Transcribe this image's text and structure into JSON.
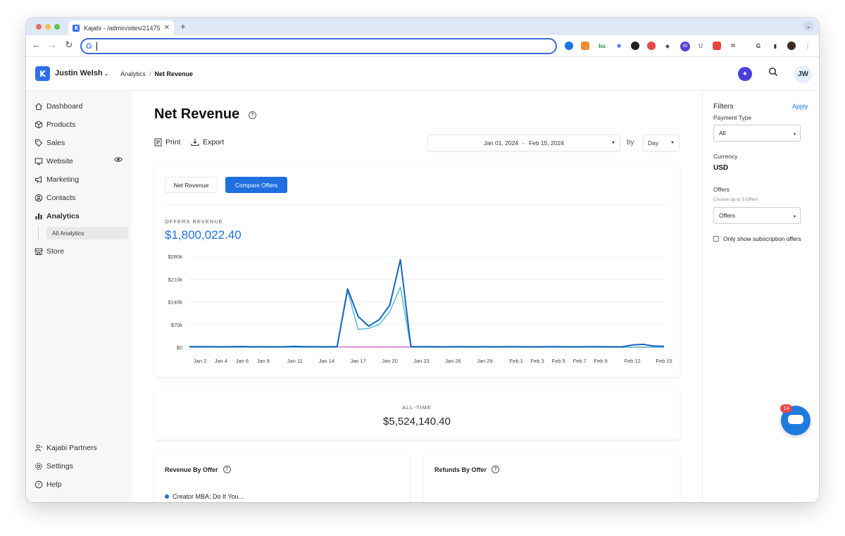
{
  "browser": {
    "tab_title": "Kajabi - /admin/sites/21475…",
    "tab_close": "✕",
    "new_tab": "+",
    "omnibox_value": "",
    "extension_badge": "60"
  },
  "header": {
    "account_name": "Justin Welsh",
    "breadcrumb": [
      "Analytics",
      "Net Revenue"
    ],
    "avatar_initials": "JW"
  },
  "sidebar": {
    "items": [
      {
        "label": "Dashboard",
        "icon": "home-icon"
      },
      {
        "label": "Products",
        "icon": "box-icon"
      },
      {
        "label": "Sales",
        "icon": "tag-icon"
      },
      {
        "label": "Website",
        "icon": "monitor-icon"
      },
      {
        "label": "Marketing",
        "icon": "megaphone-icon"
      },
      {
        "label": "Contacts",
        "icon": "user-circle-icon"
      },
      {
        "label": "Analytics",
        "icon": "bar-chart-icon"
      },
      {
        "label": "Store",
        "icon": "store-icon"
      }
    ],
    "sub_item": "All Analytics",
    "bottom_items": [
      {
        "label": "Kajabi Partners",
        "icon": "partners-icon"
      },
      {
        "label": "Settings",
        "icon": "gear-icon"
      },
      {
        "label": "Help",
        "icon": "help-icon"
      }
    ]
  },
  "main": {
    "title": "Net Revenue",
    "print_label": "Print",
    "export_label": "Export",
    "date_start": "Jan 01, 2024",
    "date_sep": "-",
    "date_end": "Feb 15, 2024",
    "by_label": "by",
    "interval": "Day",
    "tabs": [
      "Net Revenue",
      "Compare Offers"
    ],
    "metric_label": "OFFERS REVENUE",
    "metric_value": "$1,800,022.40",
    "alltime_label": "ALL-TIME",
    "alltime_value": "$5,524,140.40",
    "revenue_by_offer_title": "Revenue By Offer",
    "refunds_by_offer_title": "Refunds By Offer",
    "legend_first_offer": "Creator MBA: Do It You..."
  },
  "filters": {
    "title": "Filters",
    "apply": "Apply",
    "payment_type_label": "Payment Type",
    "payment_type_value": "All",
    "currency_label": "Currency",
    "currency_value": "USD",
    "offers_label": "Offers",
    "offers_hint": "Choose up to 5 Offers",
    "offers_value": "Offers",
    "subscription_only_label": "Only show subscription offers"
  },
  "chat": {
    "badge": "14"
  },
  "colors": {
    "accent": "#1f6fe0",
    "series_dark": "#1565c0",
    "series_light": "#5bc0d3",
    "series_pink": "#d65cc6"
  },
  "chart_data": {
    "type": "line",
    "x": [
      "Jan 1",
      "Jan 2",
      "Jan 3",
      "Jan 4",
      "Jan 5",
      "Jan 6",
      "Jan 7",
      "Jan 8",
      "Jan 9",
      "Jan 10",
      "Jan 11",
      "Jan 12",
      "Jan 13",
      "Jan 14",
      "Jan 15",
      "Jan 16",
      "Jan 17",
      "Jan 18",
      "Jan 19",
      "Jan 20",
      "Jan 21",
      "Jan 22",
      "Jan 23",
      "Jan 24",
      "Jan 25",
      "Jan 26",
      "Jan 27",
      "Jan 28",
      "Jan 29",
      "Jan 30",
      "Jan 31",
      "Feb 1",
      "Feb 2",
      "Feb 3",
      "Feb 4",
      "Feb 5",
      "Feb 6",
      "Feb 7",
      "Feb 8",
      "Feb 9",
      "Feb 10",
      "Feb 11",
      "Feb 12",
      "Feb 13",
      "Feb 14",
      "Feb 15"
    ],
    "x_tick_labels": [
      "Jan 2",
      "Jan 4",
      "Jan 6",
      "Jan 8",
      "Jan 11",
      "Jan 14",
      "Jan 17",
      "Jan 20",
      "Jan 23",
      "Jan 26",
      "Jan 29",
      "Feb 1",
      "Feb 3",
      "Feb 5",
      "Feb 7",
      "Feb 9",
      "Feb 12",
      "Feb 15"
    ],
    "y_tick_labels": [
      "$0",
      "$70k",
      "$140k",
      "$210k",
      "$280k"
    ],
    "ylim": [
      0,
      280000
    ],
    "series": [
      {
        "values": [
          2000,
          1500,
          1800,
          1200,
          1500,
          2200,
          1400,
          1600,
          1200,
          1500,
          2500,
          1800,
          1500,
          1200,
          2000,
          180000,
          95000,
          65000,
          85000,
          130000,
          270000,
          2000,
          1500,
          1800,
          1200,
          1500,
          1800,
          1400,
          1600,
          1200,
          1500,
          1800,
          1400,
          1200,
          1500,
          1600,
          1200,
          1400,
          1800,
          1500,
          1200,
          1300,
          7000,
          9000,
          4000,
          3000
        ]
      },
      {
        "values": [
          0,
          0,
          0,
          0,
          0,
          0,
          0,
          0,
          0,
          0,
          0,
          0,
          0,
          0,
          0,
          175000,
          55000,
          58000,
          70000,
          110000,
          185000,
          0,
          0,
          0,
          0,
          0,
          0,
          0,
          0,
          0,
          0,
          0,
          0,
          0,
          0,
          0,
          0,
          0,
          0,
          0,
          0,
          0,
          0,
          0,
          0,
          0
        ]
      },
      {
        "values": [
          800,
          700,
          900,
          600,
          800,
          700,
          900,
          600,
          800,
          700,
          900,
          600,
          800,
          700,
          900,
          800,
          700,
          900,
          600,
          800,
          700,
          900,
          800,
          700,
          900,
          600,
          800,
          700,
          900,
          800,
          700,
          900,
          600,
          800,
          700,
          900,
          800,
          700,
          900,
          600,
          800,
          700,
          900,
          800,
          700,
          900
        ]
      }
    ]
  }
}
